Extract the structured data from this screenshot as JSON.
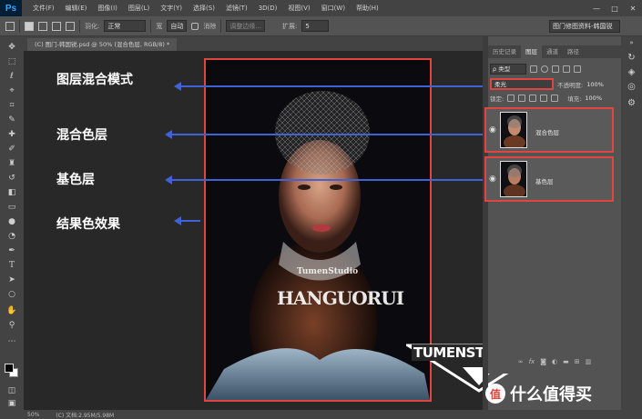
{
  "app": {
    "logo": "Ps"
  },
  "menu": [
    "文件(F)",
    "编辑(E)",
    "图像(I)",
    "图层(L)",
    "文字(Y)",
    "选择(S)",
    "滤镜(T)",
    "3D(D)",
    "视图(V)",
    "窗口(W)",
    "帮助(H)"
  ],
  "options": {
    "feather_label": "羽化:",
    "style_value": "正常",
    "width_label": "宽",
    "height_label": "高",
    "auto_label": "自动",
    "antialias_label": "消除",
    "refine_label": "调整边缘...",
    "tolerance_label": "扩展:",
    "tolerance_value": "5",
    "workspace_value": "图门修图资料-韩国锐"
  },
  "document": {
    "tab_title": "(C) 图门-韩国锐.psd @ 50% (混合色层, RGB/8) *"
  },
  "annotations": [
    "图层混合模式",
    "混合色层",
    "基色层",
    "结果色效果"
  ],
  "panel": {
    "tabs": [
      "历史记录",
      "图层",
      "通道",
      "路径"
    ],
    "kind_filter": "ρ 类型",
    "blend_mode": "柔光",
    "opacity_label": "不透明度:",
    "opacity_value": "100%",
    "lock_label": "锁定:",
    "fill_label": "填充:",
    "fill_value": "100%",
    "layers": [
      {
        "name": "混合色层"
      },
      {
        "name": "基色层"
      }
    ],
    "footer_icons": [
      "link-icon",
      "fx-icon",
      "mask-icon",
      "adjustment-icon",
      "folder-icon",
      "new-layer-icon",
      "trash-icon"
    ]
  },
  "photo": {
    "overlay_line1": "TumenStudio",
    "overlay_line2": "HANGUORUI",
    "brand": "TUMENSTUDIO"
  },
  "status": {
    "zoom": "50%",
    "doc_info": "(C) 文档:2.95M/5.98M"
  },
  "watermark": {
    "badge": "值",
    "text": "什么值得买"
  },
  "colors": {
    "highlight": "#e0463f",
    "arrow": "#3f63d6",
    "canvas_bg": "#282828"
  }
}
